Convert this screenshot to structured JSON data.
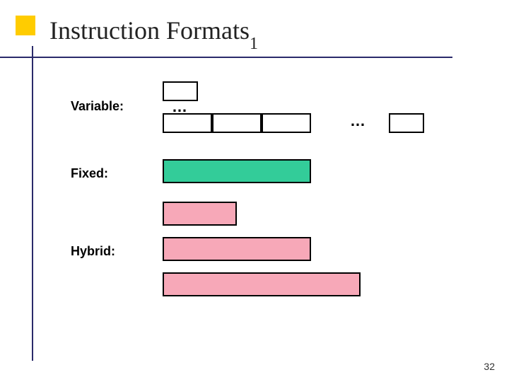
{
  "title": {
    "main": "Instruction Formats",
    "sub": "1"
  },
  "labels": {
    "variable": "Variable:",
    "fixed": "Fixed:",
    "hybrid": "Hybrid:"
  },
  "dots": {
    "a": "…",
    "b": "…"
  },
  "page_number": "32"
}
